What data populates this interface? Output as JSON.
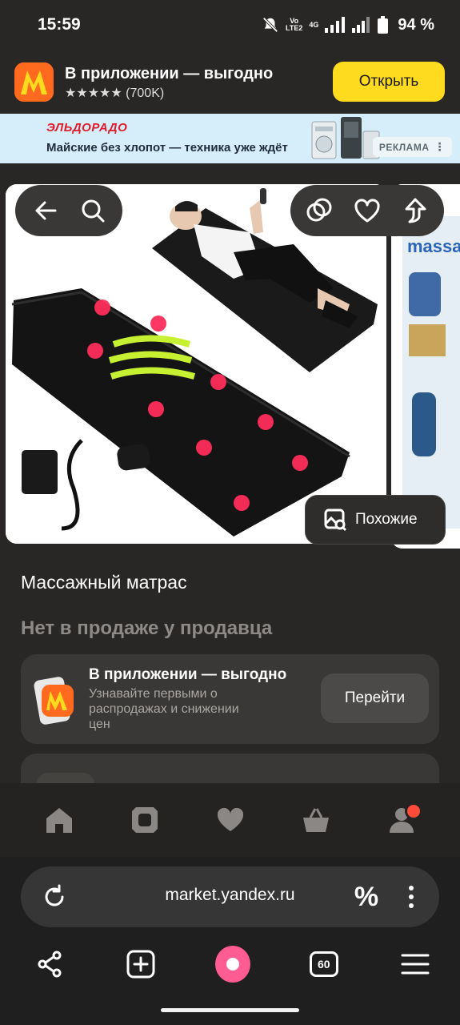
{
  "status_bar": {
    "time": "15:59",
    "network_label": "4G",
    "volte_label": "Vo\nLTE2",
    "battery": "94 %"
  },
  "app_banner": {
    "title": "В приложении — выгодно",
    "rating": "★★★★★ (700K)",
    "open_label": "Открыть"
  },
  "ad": {
    "brand": "ЭЛЬДОРАДО",
    "text": "Майские без хлопот — техника уже ждёт",
    "badge": "РЕКЛАМА"
  },
  "gallery": {
    "similar_label": "Похожие",
    "box_text": "massage"
  },
  "product": {
    "title": "Массажный матрас",
    "availability": "Нет в продаже у продавца"
  },
  "promo_card": {
    "title": "В приложении — выгодно",
    "subtitle": "Узнавайте первыми о распродажах и снижении цен",
    "button": "Перейти"
  },
  "tab_bar": {
    "items": [
      {
        "icon": "home-icon"
      },
      {
        "icon": "catalog-icon"
      },
      {
        "icon": "heart-icon"
      },
      {
        "icon": "cart-icon"
      },
      {
        "icon": "profile-icon"
      }
    ]
  },
  "browser": {
    "url": "market.yandex.ru",
    "tabs_count": "60"
  },
  "colors": {
    "accent_yellow": "#ffdb1f",
    "market_orange": "#ff6a1f",
    "alice_pink": "#ff5c93",
    "notification_red": "#ff4b3a"
  }
}
